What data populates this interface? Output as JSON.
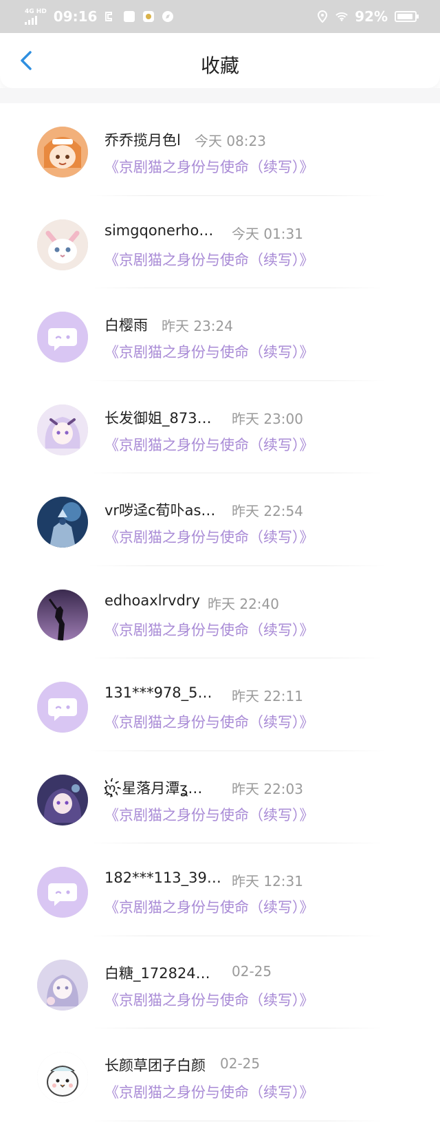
{
  "status_bar": {
    "network": "4G HD",
    "time": "09:16",
    "battery": "92%",
    "battery_level": 0.92
  },
  "header": {
    "title": "收藏",
    "back_icon": "chevron-left-icon"
  },
  "items": [
    {
      "name": "乔乔揽月色l",
      "time": "今天 08:23",
      "work": "《京剧猫之身份与使命（续写）》",
      "avatar": "anime-girl-orange"
    },
    {
      "name": "simgqonerho…",
      "time": "今天 01:31",
      "work": "《京剧猫之身份与使命（续写）》",
      "avatar": "white-cat"
    },
    {
      "name": "白樱雨",
      "time": "昨天 23:24",
      "work": "《京剧猫之身份与使命（续写）》",
      "avatar": "default-chat"
    },
    {
      "name": "长发御姐_873…",
      "time": "昨天 23:00",
      "work": "《京剧猫之身份与使命（续写）》",
      "avatar": "anime-girl-purple"
    },
    {
      "name": "vr哕迳c荀卟as…",
      "time": "昨天 22:54",
      "work": "《京剧猫之身份与使命（续写）》",
      "avatar": "armored-knight"
    },
    {
      "name": "edhoaxlrvdry",
      "time": "昨天 22:40",
      "work": "《京剧猫之身份与使命（续写）》",
      "avatar": "silhouette-sunset"
    },
    {
      "name": "131***978_5…",
      "time": "昨天 22:11",
      "work": "《京剧猫之身份与使命（续写）》",
      "avatar": "default-chat"
    },
    {
      "name": "ღ҉星落月潭ʓ…",
      "time": "昨天 22:03",
      "work": "《京剧猫之身份与使命（续写）》",
      "avatar": "anime-girl-dark"
    },
    {
      "name": "182***113_39…",
      "time": "昨天 12:31",
      "work": "《京剧猫之身份与使命（续写）》",
      "avatar": "default-chat"
    },
    {
      "name": "白糖_172824…",
      "time": "02-25",
      "work": "《京剧猫之身份与使命（续写）》",
      "avatar": "anime-girl-pale"
    },
    {
      "name": "长颜草团子白颜",
      "time": "02-25",
      "work": "《京剧猫之身份与使命（续写）》",
      "avatar": "cartoon-bird"
    }
  ]
}
